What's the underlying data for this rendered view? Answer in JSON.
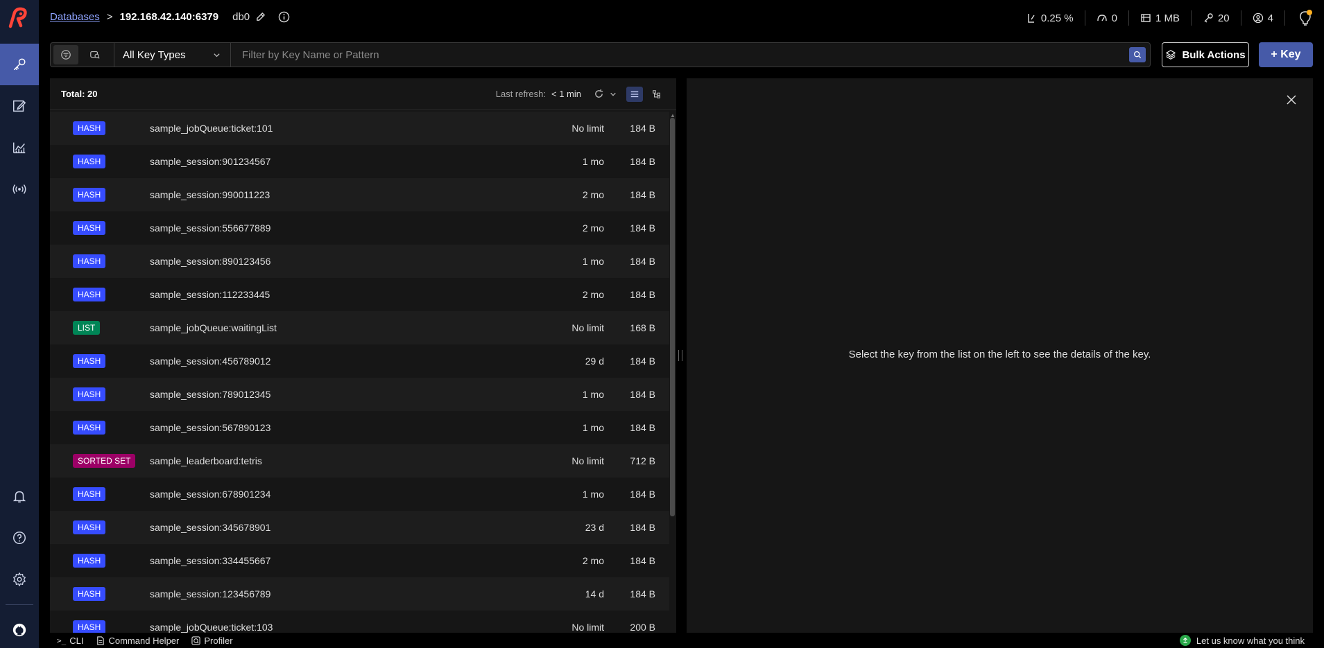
{
  "header": {
    "databases_link": "Databases",
    "separator": ">",
    "host": "192.168.42.140:6379",
    "db": "db0",
    "stats": [
      {
        "icon": "cpu-icon",
        "value": "0.25 %"
      },
      {
        "icon": "speedometer-icon",
        "value": "0"
      },
      {
        "icon": "memory-icon",
        "value": "1 MB"
      },
      {
        "icon": "key-icon",
        "value": "20"
      },
      {
        "icon": "users-icon",
        "value": "4"
      }
    ]
  },
  "sidebar": {
    "items": [
      "browser",
      "workbench",
      "analytics",
      "pub-sub"
    ],
    "bottom_items": [
      "notifications",
      "help",
      "settings",
      "github"
    ],
    "accent": "#465aa8"
  },
  "filter": {
    "type_select": "All Key Types",
    "search_placeholder": "Filter by Key Name or Pattern",
    "bulk_actions": "Bulk Actions",
    "add_key": "+ Key"
  },
  "list": {
    "total_label": "Total: 20",
    "refresh_label": "Last refresh:",
    "refresh_value": "< 1 min",
    "rows": [
      {
        "type": "HASH",
        "name": "sample_jobQueue:ticket:101",
        "ttl": "No limit",
        "size": "184 B"
      },
      {
        "type": "HASH",
        "name": "sample_session:901234567",
        "ttl": "1 mo",
        "size": "184 B"
      },
      {
        "type": "HASH",
        "name": "sample_session:990011223",
        "ttl": "2 mo",
        "size": "184 B"
      },
      {
        "type": "HASH",
        "name": "sample_session:556677889",
        "ttl": "2 mo",
        "size": "184 B"
      },
      {
        "type": "HASH",
        "name": "sample_session:890123456",
        "ttl": "1 mo",
        "size": "184 B"
      },
      {
        "type": "HASH",
        "name": "sample_session:112233445",
        "ttl": "2 mo",
        "size": "184 B"
      },
      {
        "type": "LIST",
        "name": "sample_jobQueue:waitingList",
        "ttl": "No limit",
        "size": "168 B"
      },
      {
        "type": "HASH",
        "name": "sample_session:456789012",
        "ttl": "29 d",
        "size": "184 B"
      },
      {
        "type": "HASH",
        "name": "sample_session:789012345",
        "ttl": "1 mo",
        "size": "184 B"
      },
      {
        "type": "HASH",
        "name": "sample_session:567890123",
        "ttl": "1 mo",
        "size": "184 B"
      },
      {
        "type": "SORTED SET",
        "name": "sample_leaderboard:tetris",
        "ttl": "No limit",
        "size": "712 B"
      },
      {
        "type": "HASH",
        "name": "sample_session:678901234",
        "ttl": "1 mo",
        "size": "184 B"
      },
      {
        "type": "HASH",
        "name": "sample_session:345678901",
        "ttl": "23 d",
        "size": "184 B"
      },
      {
        "type": "HASH",
        "name": "sample_session:334455667",
        "ttl": "2 mo",
        "size": "184 B"
      },
      {
        "type": "HASH",
        "name": "sample_session:123456789",
        "ttl": "14 d",
        "size": "184 B"
      },
      {
        "type": "HASH",
        "name": "sample_jobQueue:ticket:103",
        "ttl": "No limit",
        "size": "200 B"
      }
    ],
    "type_colors": {
      "HASH": "#364cff",
      "LIST": "#008556",
      "SORTED SET": "#9c0066"
    }
  },
  "details": {
    "message": "Select the key from the list on the left to see the details of the key."
  },
  "bottom": {
    "cli": "CLI",
    "command_helper": "Command Helper",
    "profiler": "Profiler",
    "feedback": "Let us know what you think"
  }
}
